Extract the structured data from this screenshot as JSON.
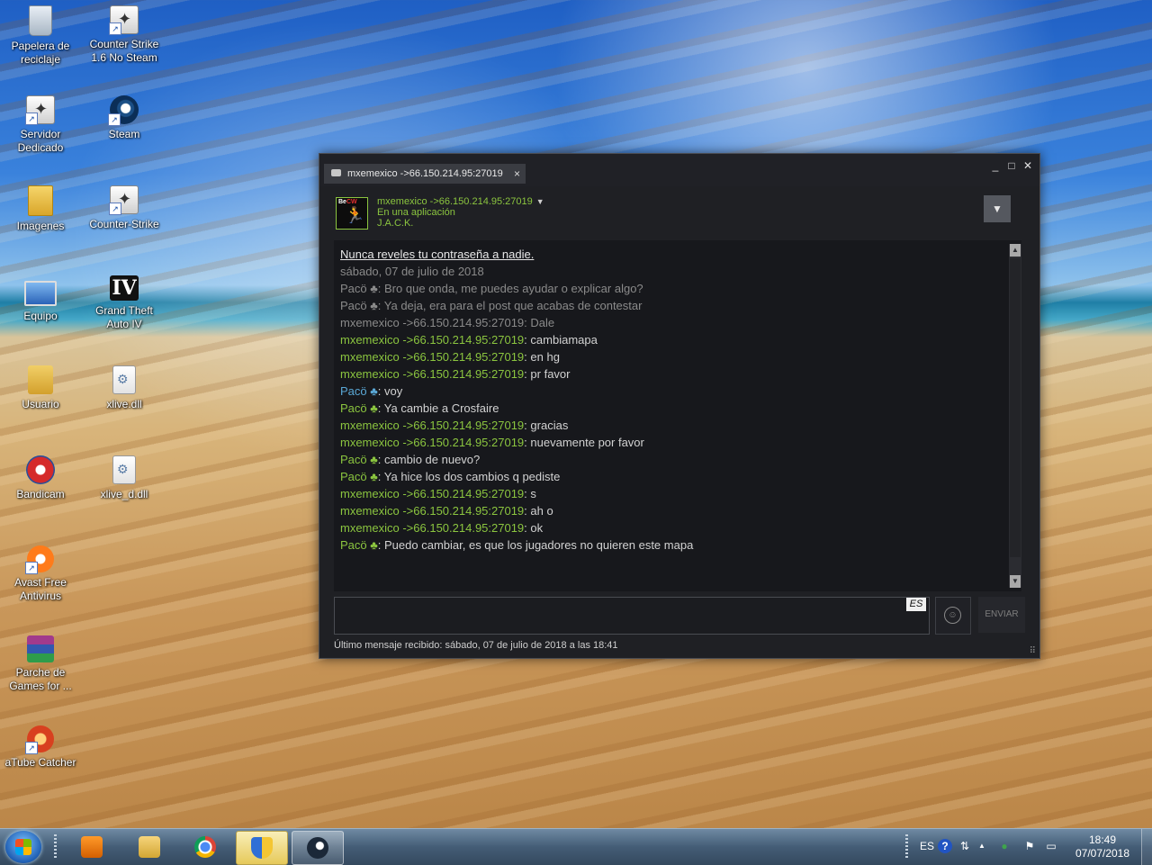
{
  "desktop": {
    "icons": [
      {
        "label": "Papelera de reciclaje",
        "icon": "recycle-bin-icon"
      },
      {
        "label": "Counter Strike 1.6 No Steam",
        "icon": "counter-strike-icon"
      },
      {
        "label": "Servidor Dedicado",
        "icon": "counter-strike-icon"
      },
      {
        "label": "Steam",
        "icon": "steam-icon"
      },
      {
        "label": "Imagenes",
        "icon": "folder-icon"
      },
      {
        "label": "Counter-Strike",
        "icon": "counter-strike-icon"
      },
      {
        "label": "Equipo",
        "icon": "computer-icon"
      },
      {
        "label": "Grand Theft Auto IV",
        "icon": "gta-icon"
      },
      {
        "label": "Usuario",
        "icon": "user-folder-icon"
      },
      {
        "label": "xlive.dll",
        "icon": "dll-file-icon"
      },
      {
        "label": "Bandicam",
        "icon": "bandicam-icon"
      },
      {
        "label": "xlive_d.dll",
        "icon": "dll-file-icon"
      },
      {
        "label": "Avast Free Antivirus",
        "icon": "avast-icon"
      },
      {
        "label": "Parche de Games for ...",
        "icon": "winrar-icon"
      },
      {
        "label": "aTube Catcher",
        "icon": "atube-catcher-icon"
      }
    ],
    "gta_glyph": "IV"
  },
  "chat": {
    "tab_title": "mxemexico ->66.150.214.95:27019",
    "tab_close": "×",
    "window_buttons": {
      "minimize": "_",
      "maximize": "□",
      "close": "✕"
    },
    "friend": {
      "name": "mxemexico ->66.150.214.95:27019",
      "caret": "▼",
      "status": "En una aplicación",
      "game": "J.A.C.K.",
      "avatar_badge_a": "Be",
      "avatar_badge_b": "CW"
    },
    "dropdown_glyph": "▼",
    "messages": [
      {
        "type": "warn",
        "text": "Nunca reveles tu contraseña a nadie."
      },
      {
        "type": "date",
        "text": "sábado, 07 de julio de 2018"
      },
      {
        "type": "old",
        "sender": "Pacö ♣",
        "text": "Bro que onda, me puedes ayudar o explicar algo?"
      },
      {
        "type": "old",
        "sender": "Pacö ♣",
        "text": "Ya deja, era para el post que acabas de contestar"
      },
      {
        "type": "old",
        "sender": "mxemexico ->66.150.214.95:27019",
        "text": "Dale"
      },
      {
        "type": "green",
        "sender": "mxemexico ->66.150.214.95:27019",
        "text": "cambiamapa"
      },
      {
        "type": "green",
        "sender": "mxemexico ->66.150.214.95:27019",
        "text": "en hg"
      },
      {
        "type": "green",
        "sender": "mxemexico ->66.150.214.95:27019",
        "text": "pr favor"
      },
      {
        "type": "blue",
        "sender": "Pacö ♣",
        "text": "voy"
      },
      {
        "type": "green",
        "sender": "Pacö ♣",
        "text": "Ya cambie a Crosfaire"
      },
      {
        "type": "green",
        "sender": "mxemexico ->66.150.214.95:27019",
        "text": "gracias"
      },
      {
        "type": "green",
        "sender": "mxemexico ->66.150.214.95:27019",
        "text": "nuevamente por favor"
      },
      {
        "type": "green",
        "sender": "Pacö ♣",
        "text": "cambio de nuevo?"
      },
      {
        "type": "green",
        "sender": "Pacö ♣",
        "text": "Ya hice los dos cambios q pediste"
      },
      {
        "type": "green",
        "sender": "mxemexico ->66.150.214.95:27019",
        "text": "s"
      },
      {
        "type": "green",
        "sender": "mxemexico ->66.150.214.95:27019",
        "text": "ah o"
      },
      {
        "type": "green",
        "sender": "mxemexico ->66.150.214.95:27019",
        "text": "ok"
      },
      {
        "type": "green",
        "sender": "Pacö ♣",
        "text": "Puedo cambiar, es que los jugadores no quieren este mapa"
      }
    ],
    "scroll_up": "▲",
    "scroll_down": "▼",
    "input_value": "",
    "lang_badge": "ES",
    "emoticon_glyph": "☺",
    "send_label": "ENVIAR",
    "last_message": "Último mensaje recibido: sábado, 07 de julio de 2018 a las 18:41",
    "resize_glyph": "⠿"
  },
  "taskbar": {
    "apps": [
      {
        "name": "media-player",
        "state": "pinned"
      },
      {
        "name": "explorer",
        "state": "pinned"
      },
      {
        "name": "chrome",
        "state": "pinned"
      },
      {
        "name": "security-center",
        "state": "active"
      },
      {
        "name": "steam",
        "state": "running"
      }
    ],
    "tray": {
      "lang": "ES",
      "help": "?",
      "network_glyph": "⇅",
      "up_arrow": "▲",
      "flag": "⚑",
      "monitor": "▭"
    },
    "time": "18:49",
    "date": "07/07/2018"
  }
}
